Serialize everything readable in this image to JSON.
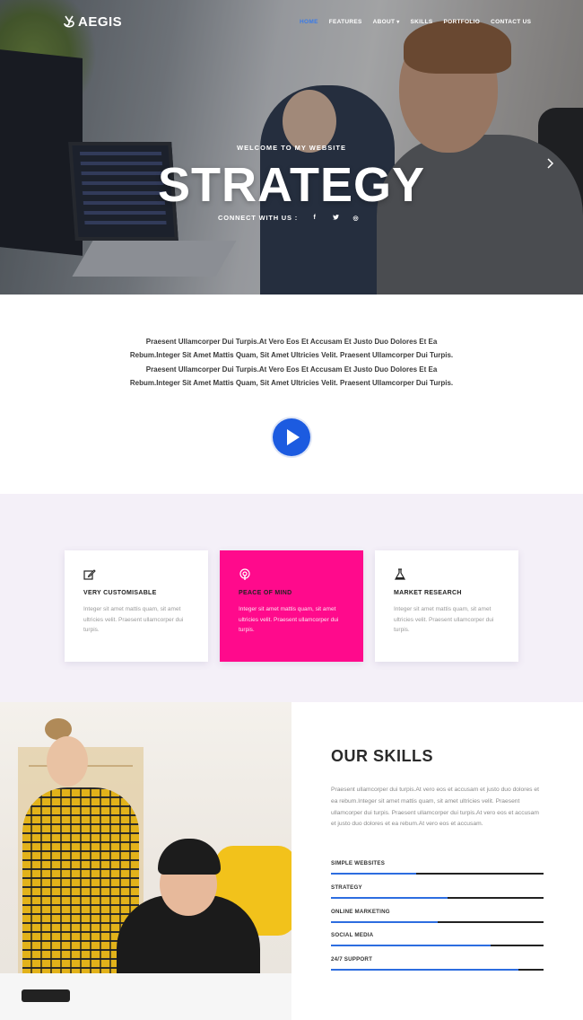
{
  "brand": {
    "name": "AEGIS"
  },
  "nav": {
    "items": [
      {
        "label": "HOME",
        "active": true
      },
      {
        "label": "FEATURES",
        "active": false
      },
      {
        "label": "ABOUT",
        "active": false
      },
      {
        "label": "SKILLS",
        "active": false
      },
      {
        "label": "PORTFOLIO",
        "active": false
      },
      {
        "label": "CONTACT US",
        "active": false
      }
    ]
  },
  "hero": {
    "subtitle": "WELCOME TO MY WEBSITE",
    "title": "STRATEGY",
    "connect_label": "CONNECT WITH US :",
    "social": [
      {
        "icon": "facebook-icon",
        "glyph": "f"
      },
      {
        "icon": "twitter-icon",
        "glyph": "t"
      },
      {
        "icon": "dribbble-icon",
        "glyph": "◎"
      }
    ],
    "next_icon": "chevron-right-icon"
  },
  "intro": {
    "text": "Praesent Ullamcorper Dui Turpis.At Vero Eos Et Accusam Et Justo Duo Dolores Et Ea Rebum.Integer Sit Amet Mattis Quam, Sit Amet Ultricies Velit. Praesent Ullamcorper Dui Turpis. Praesent Ullamcorper Dui Turpis.At Vero Eos Et Accusam Et Justo Duo Dolores Et Ea Rebum.Integer Sit Amet Mattis Quam, Sit Amet Ultricies Velit. Praesent Ullamcorper Dui Turpis.",
    "play_icon": "play-icon"
  },
  "features": [
    {
      "title": "VERY CUSTOMISABLE",
      "text": "Integer sit amet mattis quam, sit amet ultricies velit. Praesent ullamcorper dui turpis.",
      "icon": "edit-icon",
      "highlight": false
    },
    {
      "title": "PEACE OF MIND",
      "text": "Integer sit amet mattis quam, sit amet ultricies velit. Praesent ullamcorper dui turpis.",
      "icon": "podcast-icon",
      "highlight": true
    },
    {
      "title": "MARKET RESEARCH",
      "text": "Integer sit amet mattis quam, sit amet ultricies velit. Praesent ullamcorper dui turpis.",
      "icon": "flask-icon",
      "highlight": false
    }
  ],
  "skills": {
    "title": "OUR SKILLS",
    "description": "Praesent ullamcorper dui turpis.At vero eos et accusam et justo duo dolores et ea rebum.Integer sit amet mattis quam, sit amet ultricies velit. Praesent ullamcorper dui turpis. Praesent ullamcorper dui turpis.At vero eos et accusam et justo duo dolores et ea rebum.At vero eos et accusam.",
    "items": [
      {
        "label": "SIMPLE WEBSITES",
        "level": 0.4
      },
      {
        "label": "STRATEGY",
        "level": 0.55
      },
      {
        "label": "ONLINE MARKETING",
        "level": 0.5
      },
      {
        "label": "SOCIAL MEDIA",
        "level": 0.75
      },
      {
        "label": "24/7 SUPPORT",
        "level": 0.88
      }
    ]
  },
  "colors": {
    "accent": "#2d6de0",
    "highlight": "#ff0a8c",
    "features_bg": "#f4f0f8"
  }
}
